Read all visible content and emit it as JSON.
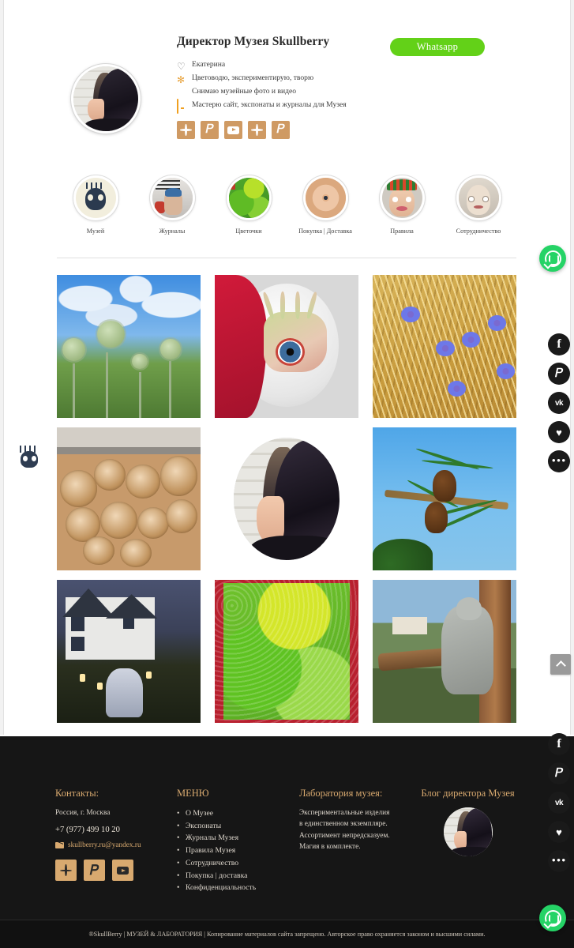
{
  "profile": {
    "name": "Директор Музея Skullberry",
    "avatar_alt": "avatar-illustration",
    "whatsapp_button": "Whatsapp",
    "bio": [
      {
        "icon": "heart-icon",
        "text": "Екатерина"
      },
      {
        "icon": "flower-icon",
        "text": "Цветоводю, экспериментирую, творю"
      },
      {
        "icon": "youtube-icon",
        "text": "Снимаю музейные фото и видео"
      },
      {
        "icon": "monitor-icon",
        "text": "Мастерю сайт, экспонаты и журналы для Музея"
      }
    ],
    "social_icons": [
      "sparkle-icon",
      "pinterest-icon",
      "youtube-icon",
      "sparkle-icon",
      "pinterest-icon"
    ]
  },
  "categories": [
    {
      "label": "Музей",
      "image": "skull-illustration"
    },
    {
      "label": "Журналы",
      "image": "magazine-cover"
    },
    {
      "label": "Цветочки",
      "image": "green-moss"
    },
    {
      "label": "Покупка | Доставка",
      "image": "clay-eye-disc"
    },
    {
      "label": "Правила",
      "image": "doll-head-hat"
    },
    {
      "label": "Сотрудничество",
      "image": "doll-head-wrapped"
    }
  ],
  "gallery": [
    {
      "alt": "thistle-flowers-sky"
    },
    {
      "alt": "clay-hand-eye-sculpture"
    },
    {
      "alt": "wheat-field-cornflowers"
    },
    {
      "alt": "stacked-firewood-logs"
    },
    {
      "alt": "director-avatar-portrait"
    },
    {
      "alt": "pine-cone-branch-sky"
    },
    {
      "alt": "house-night-ghost-figure"
    },
    {
      "alt": "green-moss-closeup"
    },
    {
      "alt": "stone-statue-on-tree"
    }
  ],
  "footer": {
    "contacts": {
      "heading": "Контакты:",
      "address": "Россия, г. Москва",
      "phone": "+7 (977) 499 10 20",
      "email": "skullberry.ru@yandex.ru",
      "social_icons": [
        "sparkle-icon",
        "pinterest-icon",
        "youtube-icon"
      ]
    },
    "menu": {
      "heading": "МЕНЮ",
      "items": [
        "О Музее",
        "Экспонаты",
        "Журналы Музея",
        "Правила Музея",
        "Сотрудничество",
        "Покупка | доставка",
        "Конфиденциальность"
      ]
    },
    "lab": {
      "heading": "Лаборатория музея:",
      "text": "Экспериментальные изделия в единственном экземпляре. Ассортимент непредсказуем. Магия в комплекте."
    },
    "blog": {
      "heading": "Блог директора Музея",
      "avatar_alt": "director-avatar"
    }
  },
  "copyright": "®SkullBerry | МУЗЕЙ & ЛАБОРАТОРИЯ | Копирование материалов сайта запрещено. Авторское право охраняется законом и высшими силами.",
  "widgets": {
    "whatsapp_float": "whatsapp-icon",
    "scroll_top": "chevron-up-icon",
    "skull_badge": "skull-icon",
    "share_buttons": [
      {
        "icon": "facebook-icon",
        "glyph": "f"
      },
      {
        "icon": "pinterest-icon",
        "glyph": "P"
      },
      {
        "icon": "vk-icon",
        "glyph": "vk"
      },
      {
        "icon": "heart-icon",
        "glyph": "♥"
      },
      {
        "icon": "more-icon",
        "glyph": "•••"
      }
    ]
  },
  "colors": {
    "accent_tan": "#cf9a63",
    "footer_bg": "#161616",
    "whatsapp_green": "#25d366",
    "button_green": "#63d118",
    "footer_heading": "#d8a96f"
  }
}
